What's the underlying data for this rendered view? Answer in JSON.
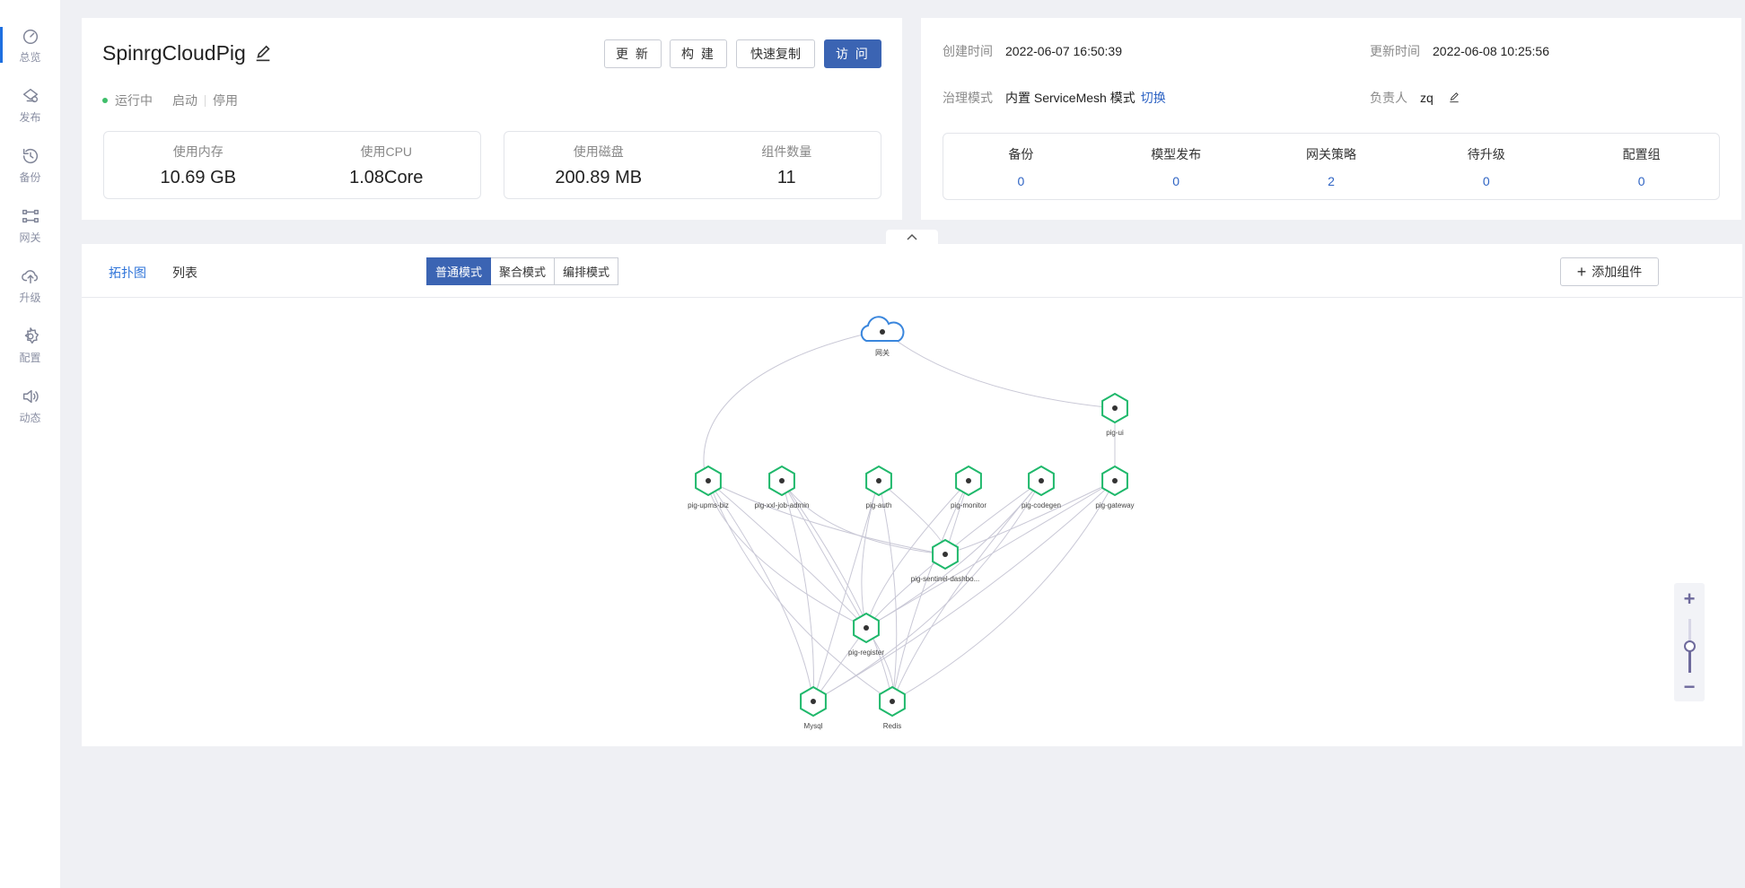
{
  "sidebar": {
    "items": [
      {
        "label": "总览",
        "icon": "dashboard-icon"
      },
      {
        "label": "发布",
        "icon": "publish-icon"
      },
      {
        "label": "备份",
        "icon": "backup-icon"
      },
      {
        "label": "网关",
        "icon": "gateway-icon"
      },
      {
        "label": "升级",
        "icon": "upgrade-icon"
      },
      {
        "label": "配置",
        "icon": "settings-icon"
      },
      {
        "label": "动态",
        "icon": "activity-icon"
      }
    ]
  },
  "app": {
    "name": "SpinrgCloudPig",
    "buttons": {
      "update": "更 新",
      "build": "构 建",
      "quick_copy": "快速复制",
      "visit": "访 问"
    },
    "status": {
      "state": "运行中",
      "start": "启动",
      "stop": "停用"
    },
    "metrics": [
      {
        "label": "使用内存",
        "value": "10.69 GB"
      },
      {
        "label": "使用CPU",
        "value": "1.08Core"
      },
      {
        "label": "使用磁盘",
        "value": "200.89 MB"
      },
      {
        "label": "组件数量",
        "value": "11"
      }
    ]
  },
  "details": {
    "created_label": "创建时间",
    "created_value": "2022-06-07 16:50:39",
    "updated_label": "更新时间",
    "updated_value": "2022-06-08 10:25:56",
    "governance_label": "治理模式",
    "governance_value": "内置 ServiceMesh 模式",
    "governance_switch": "切换",
    "owner_label": "负责人",
    "owner_value": "zq",
    "stats": [
      {
        "label": "备份",
        "value": "0"
      },
      {
        "label": "模型发布",
        "value": "0"
      },
      {
        "label": "网关策略",
        "value": "2"
      },
      {
        "label": "待升级",
        "value": "0"
      },
      {
        "label": "配置组",
        "value": "0"
      }
    ]
  },
  "topology": {
    "tabs": {
      "graph": "拓扑图",
      "list": "列表"
    },
    "modes": {
      "normal": "普通模式",
      "aggregate": "聚合模式",
      "arrange": "编排模式"
    },
    "add_component": "添加组件",
    "nodes": [
      {
        "id": "gateway",
        "label": "网关",
        "kind": "cloud"
      },
      {
        "id": "ui",
        "label": "pig-ui"
      },
      {
        "id": "upms",
        "label": "pig-upms-biz"
      },
      {
        "id": "xxl",
        "label": "pig-xxl-job-admin"
      },
      {
        "id": "auth",
        "label": "pig-auth"
      },
      {
        "id": "monitor",
        "label": "pig-monitor"
      },
      {
        "id": "codegen",
        "label": "pig-codegen"
      },
      {
        "id": "pgateway",
        "label": "pig-gateway"
      },
      {
        "id": "sentinel",
        "label": "pig-sentinel-dashbo..."
      },
      {
        "id": "register",
        "label": "pig-register"
      },
      {
        "id": "mysql",
        "label": "Mysql"
      },
      {
        "id": "redis",
        "label": "Redis"
      }
    ],
    "edges": [
      [
        "gateway",
        "ui"
      ],
      [
        "gateway",
        "register"
      ],
      [
        "ui",
        "pgateway"
      ],
      [
        "upms",
        "register"
      ],
      [
        "upms",
        "mysql"
      ],
      [
        "upms",
        "redis"
      ],
      [
        "upms",
        "sentinel"
      ],
      [
        "xxl",
        "register"
      ],
      [
        "xxl",
        "mysql"
      ],
      [
        "xxl",
        "redis"
      ],
      [
        "xxl",
        "sentinel"
      ],
      [
        "auth",
        "register"
      ],
      [
        "auth",
        "mysql"
      ],
      [
        "auth",
        "redis"
      ],
      [
        "auth",
        "sentinel"
      ],
      [
        "monitor",
        "register"
      ],
      [
        "monitor",
        "redis"
      ],
      [
        "monitor",
        "sentinel"
      ],
      [
        "codegen",
        "register"
      ],
      [
        "codegen",
        "mysql"
      ],
      [
        "codegen",
        "redis"
      ],
      [
        "codegen",
        "sentinel"
      ],
      [
        "pgateway",
        "register"
      ],
      [
        "pgateway",
        "mysql"
      ],
      [
        "pgateway",
        "redis"
      ],
      [
        "pgateway",
        "sentinel"
      ],
      [
        "sentinel",
        "register"
      ],
      [
        "register",
        "mysql"
      ],
      [
        "register",
        "redis"
      ]
    ],
    "zoom_level": 0.4
  }
}
